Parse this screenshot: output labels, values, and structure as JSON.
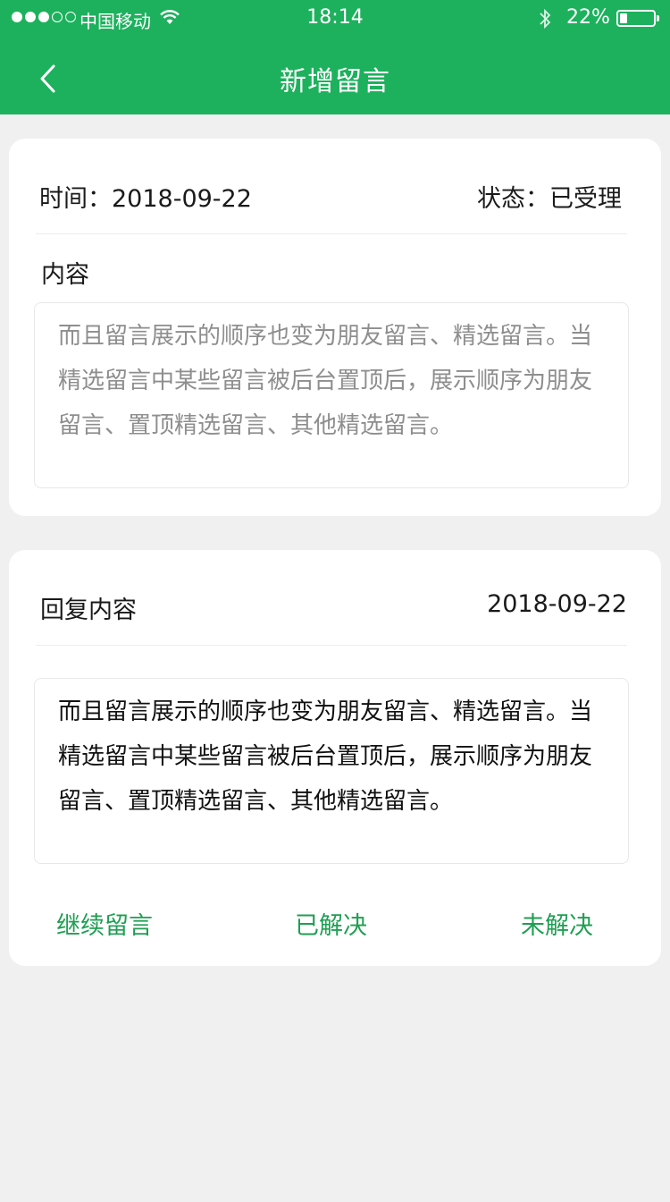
{
  "status_bar": {
    "carrier": "中国移动",
    "time": "18:14",
    "battery": "22%",
    "battery_level": 0.22
  },
  "header": {
    "title": "新增留言"
  },
  "message_card": {
    "time_text": "时间：2018-09-22",
    "status_text": "状态：已受理",
    "content_label": "内容",
    "content_text": "而且留言展示的顺序也变为朋友留言、精选留言。当精选留言中某些留言被后台置顶后，展示顺序为朋友留言、置顶精选留言、其他精选留言。"
  },
  "reply_card": {
    "label": "回复内容",
    "date": "2018-09-22",
    "reply_text": "而且留言展示的顺序也变为朋友留言、精选留言。当精选留言中某些留言被后台置顶后，展示顺序为朋友留言、置顶精选留言、其他精选留言。",
    "actions": {
      "continue": "继续留言",
      "resolved": "已解决",
      "unresolved": "未解决"
    }
  },
  "colors": {
    "brand_green": "#1db15d",
    "action_green": "#1f9f52",
    "background": "#f0f0f0"
  }
}
